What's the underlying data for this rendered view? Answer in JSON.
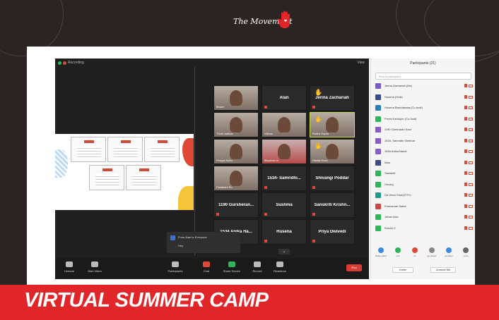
{
  "brand": {
    "text": "The Movement",
    "hand_icon": "hand-icon",
    "accent": "#e1262a"
  },
  "meeting": {
    "recording_label": "Recording",
    "view_label": "View",
    "tiles": [
      {
        "label": "Bhumi",
        "type": "photo"
      },
      {
        "label": "Alan",
        "type": "name"
      },
      {
        "label": "Jerina Zachariah",
        "type": "name",
        "hand": true
      },
      {
        "label": "Thulli Jadhav",
        "type": "photo"
      },
      {
        "label": "Vishnu",
        "type": "photo"
      },
      {
        "label": "Rudra Gupta",
        "type": "photo",
        "active": true
      },
      {
        "label": "Pranjal Sahu",
        "type": "photo"
      },
      {
        "label": "Bhushan ra",
        "type": "photo"
      },
      {
        "label": "Nishat Khan",
        "type": "photo",
        "hand": true
      },
      {
        "label": "Panakshi Ro",
        "type": "photo"
      },
      {
        "label": "1534- Samridhi...",
        "type": "name"
      },
      {
        "label": "Shivangi Poddar",
        "type": "name"
      },
      {
        "label": "1190 Gursheran...",
        "type": "name"
      },
      {
        "label": "Sushma",
        "type": "name"
      },
      {
        "label": "Sanskriti Krishn...",
        "type": "name"
      },
      {
        "label": "1534 Anika Ha...",
        "type": "name"
      },
      {
        "label": "Husena",
        "type": "name"
      },
      {
        "label": "Priya Dwivedi",
        "type": "name"
      }
    ],
    "chat_popup": {
      "from": "From Alan to Everyone",
      "message": "Hey"
    },
    "toolbar": [
      {
        "label": "Unmute",
        "icon": "mic-icon"
      },
      {
        "label": "Start Video",
        "icon": "video-icon"
      },
      {
        "label": "Participants",
        "icon": "participants-icon"
      },
      {
        "label": "Chat",
        "icon": "chat-icon"
      },
      {
        "label": "Share Screen",
        "icon": "share-screen-icon"
      },
      {
        "label": "Record",
        "icon": "record-icon"
      },
      {
        "label": "Reactions",
        "icon": "reactions-icon"
      }
    ],
    "end_label": "End"
  },
  "participants": {
    "title": "Participants (21)",
    "search_placeholder": "Find a participant",
    "list": [
      {
        "name": "Jerina Zachariah (Me)",
        "color": "#7b59c9"
      },
      {
        "name": "Husena (Host)",
        "color": "#3b4a8a"
      },
      {
        "name": "Husena Barodawala (Co-host)",
        "color": "#2a7fb8"
      },
      {
        "name": "Preeti Karhujee (Co-host)",
        "color": "#2fb45a"
      },
      {
        "name": "1190 Gursharan Kaur",
        "color": "#8a5ac9"
      },
      {
        "name": "1534- Samridhi Shekhar",
        "color": "#8a5ac9"
      },
      {
        "name": "1534 Anika Nandi",
        "color": "#8a5ac9"
      },
      {
        "name": "Alan",
        "color": "#3b4a8a"
      },
      {
        "name": "Sanskriti",
        "color": "#2fb45a"
      },
      {
        "name": "Devanj",
        "color": "#2fb45a"
      },
      {
        "name": "Da Venci Khan(OTC)",
        "color": "#1f9a8a"
      },
      {
        "name": "Emmanuel Sabre",
        "color": "#c94a4a"
      },
      {
        "name": "Jehan Alax",
        "color": "#2fb45a"
      },
      {
        "name": "Rohan C",
        "color": "#2fb45a"
      }
    ],
    "reactions": [
      {
        "label": "Raise Hand",
        "color": "#3b8ad9"
      },
      {
        "label": "yes",
        "color": "#2fb45a"
      },
      {
        "label": "no",
        "color": "#e04836"
      },
      {
        "label": "go slower",
        "color": "#888888"
      },
      {
        "label": "go faster",
        "color": "#3b8ad9"
      },
      {
        "label": "more",
        "color": "#666666"
      }
    ],
    "buttons": {
      "invite": "Invite",
      "unmute_me": "Unmute Me"
    }
  },
  "banner": {
    "title": "VIRTUAL SUMMER CAMP"
  }
}
